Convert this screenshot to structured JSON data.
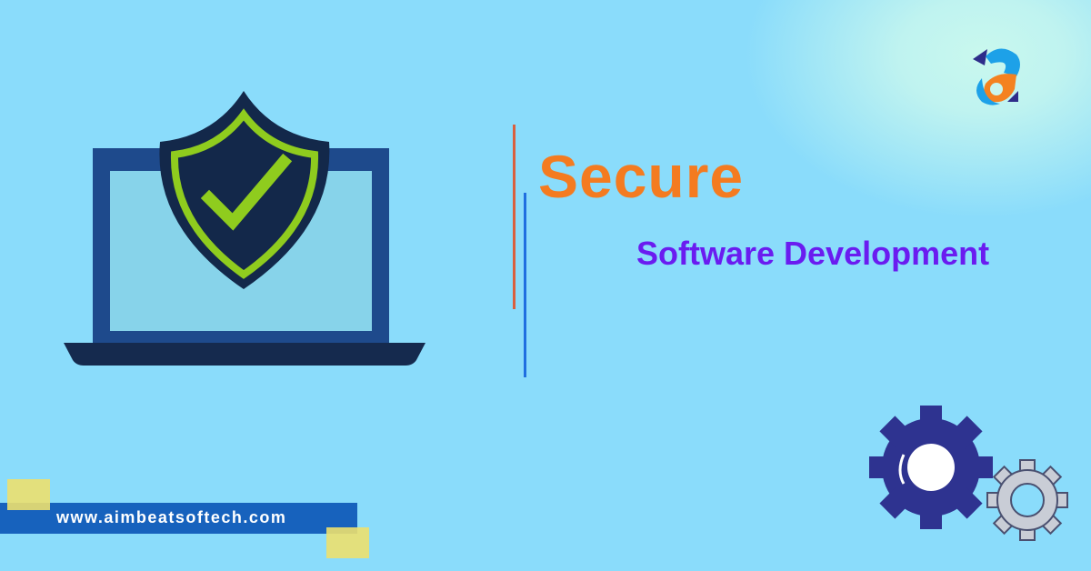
{
  "heading": {
    "title": "Secure",
    "subtitle": "Software Development"
  },
  "footer": {
    "url": "www.aimbeatsoftech.com"
  },
  "brand": {
    "logo": "aimbeat-logo"
  },
  "colors": {
    "background": "#8adcfb",
    "title": "#f47b20",
    "subtitle": "#6a1cf0",
    "shield_check": "#8fcc1e",
    "gear_primary": "#2e3390",
    "gear_secondary": "#c9cdd6",
    "url_bar": "#1762bd"
  }
}
